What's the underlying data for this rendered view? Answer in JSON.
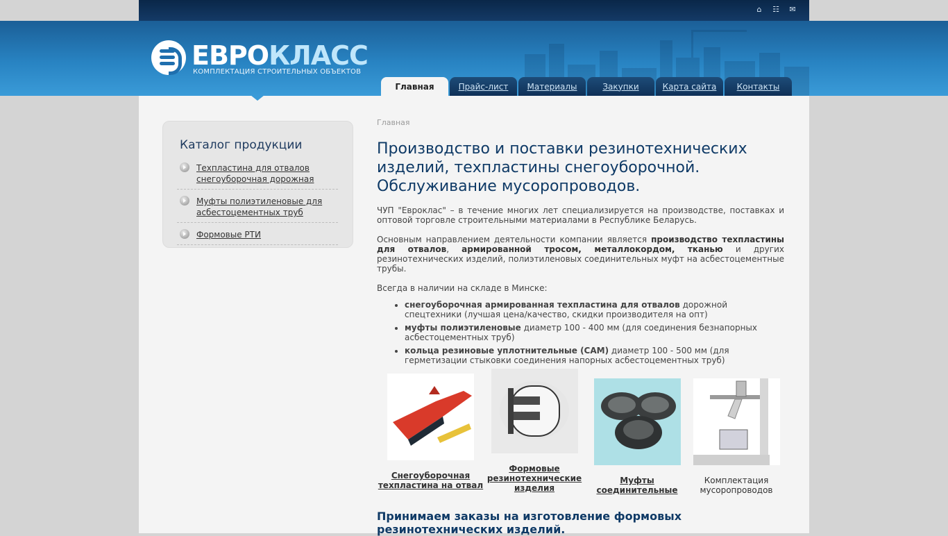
{
  "header": {
    "logo_part1": "ЕВРО",
    "logo_part2": "КЛАСС",
    "logo_subtitle": "КОМПЛЕКТАЦИЯ СТРОИТЕЛЬНЫХ ОБЪЕКТОВ",
    "top_icons": [
      "home-icon",
      "sitemap-icon",
      "mail-icon"
    ]
  },
  "nav": {
    "tabs": [
      {
        "label": "Главная",
        "active": true
      },
      {
        "label": "Прайс-лист"
      },
      {
        "label": "Материалы"
      },
      {
        "label": "Закупки"
      },
      {
        "label": "Карта сайта"
      },
      {
        "label": "Контакты"
      }
    ]
  },
  "sidebar": {
    "title": "Каталог продукции",
    "items": [
      {
        "label": "Техпластина для отвалов снегоуборочная дорожная"
      },
      {
        "label": "Муфты полиэтиленовые для асбестоцементных труб"
      },
      {
        "label": "Формовые РТИ"
      }
    ]
  },
  "main": {
    "breadcrumb": "Главная",
    "title": "Производство и поставки резинотехнических изделий, техпластины снегоуборочной. Обслуживание мусоропроводов.",
    "intro": "ЧУП \"Евроклас\" – в течение многих лет специализируется на производстве, поставках и оптовой торговле строительными материалами в Республике Беларусь.",
    "direction_prefix": "Основным направлением деятельности компании является ",
    "direction_bold1": "производство техпластины для отвалов",
    "direction_mid1": ", ",
    "direction_bold2": "армированной тросом, металлокордом, тканью",
    "direction_suffix": " и других резинотехнических изделий, полиэтиленовых соединительных муфт на асбестоцементные трубы.",
    "stock_intro": "Всегда в наличии на складе в  Минске:",
    "stock": [
      {
        "bold": "снегоуборочная армированная техпластина для отвалов",
        "text": " дорожной спецтехники (лучшая цена/качество, скидки производителя на опт)"
      },
      {
        "bold": "муфты полиэтиленовые",
        "text": " диаметр 100 - 400 мм (для соединения безнапорных асбестоцементных труб)"
      },
      {
        "bold": "кольца резиновые уплотнительные (САМ)",
        "text": " диаметр 100 - 500 мм (для герметизации стыковки соединения напорных асбестоцементных труб)"
      }
    ],
    "products": [
      {
        "caption": "Снегоуборочная техпластина на отвал",
        "icon": "snowplow-blade-image",
        "link": true
      },
      {
        "caption": "Формовые резинотехнические изделия",
        "icon": "rubber-rings-image",
        "link": true
      },
      {
        "caption": "Муфты соединительные",
        "icon": "couplings-image",
        "link": true
      },
      {
        "caption": "Комплектация мусоропроводов",
        "icon": "garbage-chute-image",
        "link": false
      }
    ],
    "orders_heading": "Принимаем заказы на изготовление формовых резинотехнических изделий."
  }
}
